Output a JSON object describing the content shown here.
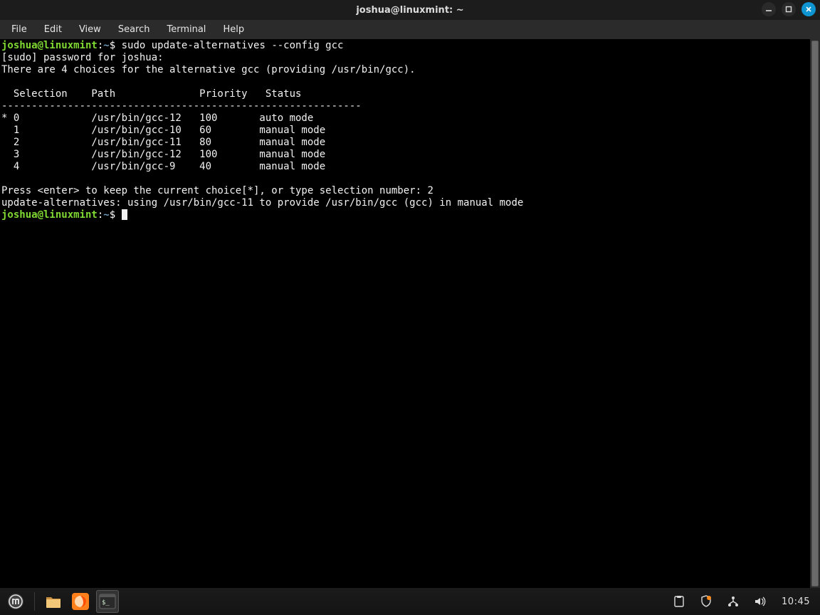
{
  "window": {
    "title": "joshua@linuxmint: ~"
  },
  "menubar": {
    "items": [
      "File",
      "Edit",
      "View",
      "Search",
      "Terminal",
      "Help"
    ]
  },
  "terminal": {
    "prompt_user": "joshua@linuxmint",
    "prompt_sep": ":",
    "prompt_path": "~",
    "prompt_symbol": "$",
    "cmd1": "sudo update-alternatives --config gcc",
    "sudo_line": "[sudo] password for joshua:",
    "choices_line": "There are 4 choices for the alternative gcc (providing /usr/bin/gcc).",
    "header": "  Selection    Path              Priority   Status",
    "dashes": "------------------------------------------------------------",
    "rows": [
      "* 0            /usr/bin/gcc-12   100       auto mode",
      "  1            /usr/bin/gcc-10   60        manual mode",
      "  2            /usr/bin/gcc-11   80        manual mode",
      "  3            /usr/bin/gcc-12   100       manual mode",
      "  4            /usr/bin/gcc-9    40        manual mode"
    ],
    "press_line": "Press <enter> to keep the current choice[*], or type selection number: 2",
    "result_line": "update-alternatives: using /usr/bin/gcc-11 to provide /usr/bin/gcc (gcc) in manual mode"
  },
  "panel": {
    "clock": "10:45"
  }
}
